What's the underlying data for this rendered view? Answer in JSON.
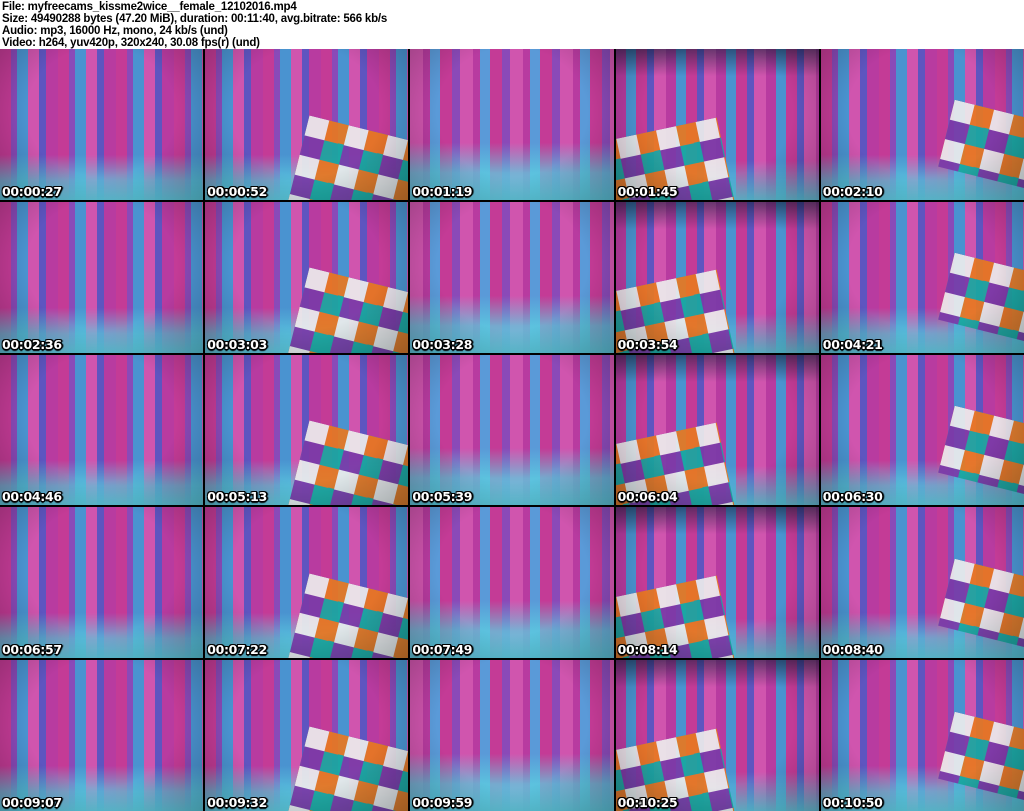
{
  "header": {
    "lines": [
      {
        "name": "file",
        "text": "File: myfreecams_kissme2wice__female_12102016.mp4"
      },
      {
        "name": "size",
        "text": "Size: 49490288 bytes (47.20 MiB), duration: 00:11:40, avg.bitrate: 566 kb/s"
      },
      {
        "name": "audio",
        "text": "Audio: mp3, 16000 Hz, mono, 24 kb/s (und)"
      },
      {
        "name": "video",
        "text": "Video: h264, yuv420p, 320x240, 30.08 fps(r) (und)"
      }
    ]
  },
  "grid": {
    "rows": 5,
    "cols": 5,
    "thumbnails": [
      {
        "timestamp": "00:00:27"
      },
      {
        "timestamp": "00:00:52"
      },
      {
        "timestamp": "00:01:19"
      },
      {
        "timestamp": "00:01:45"
      },
      {
        "timestamp": "00:02:10"
      },
      {
        "timestamp": "00:02:36"
      },
      {
        "timestamp": "00:03:03"
      },
      {
        "timestamp": "00:03:28"
      },
      {
        "timestamp": "00:03:54"
      },
      {
        "timestamp": "00:04:21"
      },
      {
        "timestamp": "00:04:46"
      },
      {
        "timestamp": "00:05:13"
      },
      {
        "timestamp": "00:05:39"
      },
      {
        "timestamp": "00:06:04"
      },
      {
        "timestamp": "00:06:30"
      },
      {
        "timestamp": "00:06:57"
      },
      {
        "timestamp": "00:07:22"
      },
      {
        "timestamp": "00:07:49"
      },
      {
        "timestamp": "00:08:14"
      },
      {
        "timestamp": "00:08:40"
      },
      {
        "timestamp": "00:09:07"
      },
      {
        "timestamp": "00:09:32"
      },
      {
        "timestamp": "00:09:59"
      },
      {
        "timestamp": "00:10:25"
      },
      {
        "timestamp": "00:10:50"
      }
    ]
  },
  "colors": {
    "header_bg": "#ffffff",
    "header_text": "#000000",
    "grid_gap": "#000000",
    "timestamp_text": "#ffffff",
    "timestamp_outline": "#000000",
    "scene_palette": [
      "#c43b96",
      "#8a4ab8",
      "#4a93d0",
      "#5cced0",
      "#e87820",
      "#18a8a0",
      "#ececec"
    ]
  }
}
